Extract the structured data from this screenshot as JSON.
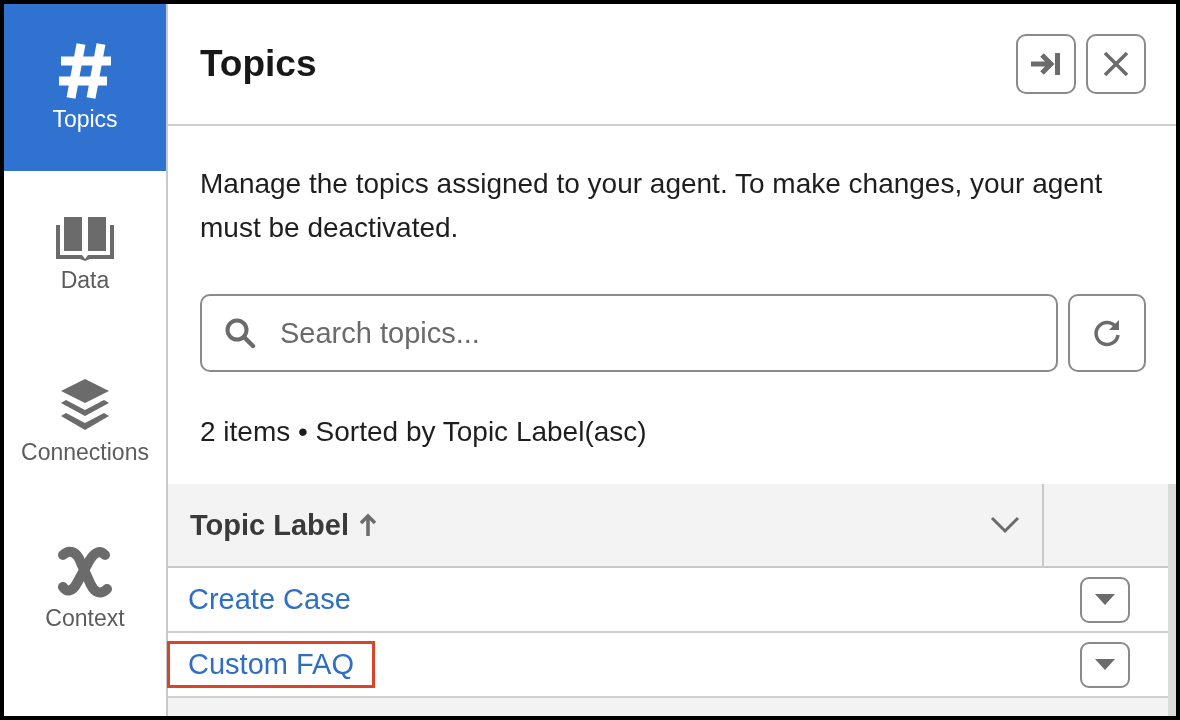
{
  "sidebar": {
    "items": [
      {
        "label": "Topics",
        "kind": "hash",
        "selected": true
      },
      {
        "label": "Data",
        "kind": "book",
        "selected": false
      },
      {
        "label": "Connections",
        "kind": "layers",
        "selected": false
      },
      {
        "label": "Context",
        "kind": "variable",
        "selected": false
      }
    ]
  },
  "panel": {
    "title": "Topics",
    "description": "Manage the topics assigned to your agent. To make changes, your agent must be deactivated.",
    "search": {
      "placeholder": "Search topics..."
    },
    "summary": "2 items • Sorted by Topic Label(asc)",
    "table": {
      "columns": [
        {
          "label": "Topic Label",
          "sort_ascending": true
        }
      ],
      "rows": [
        {
          "label": "Create Case",
          "highlighted": false
        },
        {
          "label": "Custom FAQ",
          "highlighted": true
        }
      ]
    }
  }
}
